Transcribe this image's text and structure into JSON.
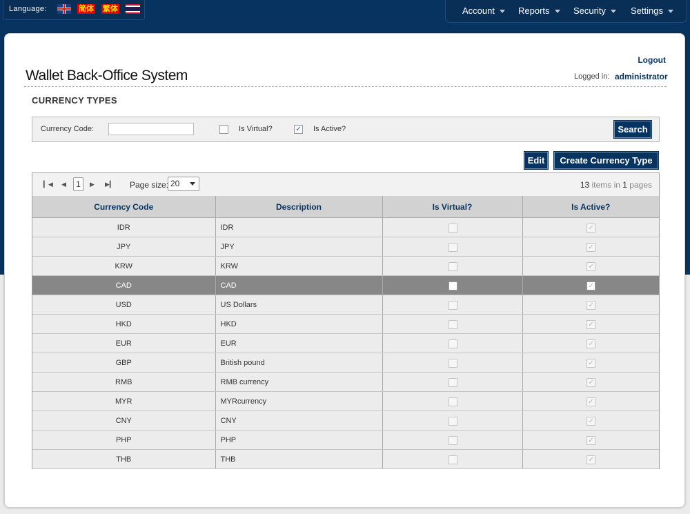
{
  "language_bar": {
    "label": "Language:",
    "flags": [
      {
        "name": "english",
        "text": ""
      },
      {
        "name": "simplified-chinese",
        "text": "简体"
      },
      {
        "name": "traditional-chinese",
        "text": "繁体"
      },
      {
        "name": "thai",
        "text": ""
      }
    ]
  },
  "menu": {
    "items": [
      "Account",
      "Reports",
      "Security",
      "Settings"
    ]
  },
  "header": {
    "app_title": "Wallet Back-Office System",
    "logout": "Logout",
    "logged_in_label": "Logged in:",
    "user": "administrator"
  },
  "page": {
    "section_title": "CURRENCY TYPES"
  },
  "filter": {
    "currency_code_label": "Currency Code:",
    "currency_code_value": "",
    "is_virtual_label": "Is Virtual?",
    "is_virtual_checked": false,
    "is_active_label": "Is Active?",
    "is_active_checked": true,
    "search_label": "Search"
  },
  "actions": {
    "edit_label": "Edit",
    "create_label": "Create Currency Type"
  },
  "pager": {
    "current_page": "1",
    "page_size_label": "Page size:",
    "page_size": "20",
    "total_items": "13",
    "items_in_text": "items in",
    "total_pages": "1",
    "pages_text": "pages"
  },
  "table": {
    "columns": [
      "Currency Code",
      "Description",
      "Is Virtual?",
      "Is Active?"
    ],
    "selected_index": 3,
    "rows": [
      {
        "code": "IDR",
        "description": "IDR",
        "virtual": false,
        "active": true
      },
      {
        "code": "JPY",
        "description": "JPY",
        "virtual": false,
        "active": true
      },
      {
        "code": "KRW",
        "description": "KRW",
        "virtual": false,
        "active": true
      },
      {
        "code": "CAD",
        "description": "CAD",
        "virtual": false,
        "active": true
      },
      {
        "code": "USD",
        "description": "US Dollars",
        "virtual": false,
        "active": true
      },
      {
        "code": "HKD",
        "description": "HKD",
        "virtual": false,
        "active": true
      },
      {
        "code": "EUR",
        "description": "EUR",
        "virtual": false,
        "active": true
      },
      {
        "code": "GBP",
        "description": "British pound",
        "virtual": false,
        "active": true
      },
      {
        "code": "RMB",
        "description": "RMB currency",
        "virtual": false,
        "active": true
      },
      {
        "code": "MYR",
        "description": "MYRcurrency",
        "virtual": false,
        "active": true
      },
      {
        "code": "CNY",
        "description": "CNY",
        "virtual": false,
        "active": true
      },
      {
        "code": "PHP",
        "description": "PHP",
        "virtual": false,
        "active": true
      },
      {
        "code": "THB",
        "description": "THB",
        "virtual": false,
        "active": true
      }
    ]
  },
  "colors": {
    "brand_navy": "#06335f",
    "selected_row": "#878787",
    "header_bg": "#d2d2d2"
  }
}
